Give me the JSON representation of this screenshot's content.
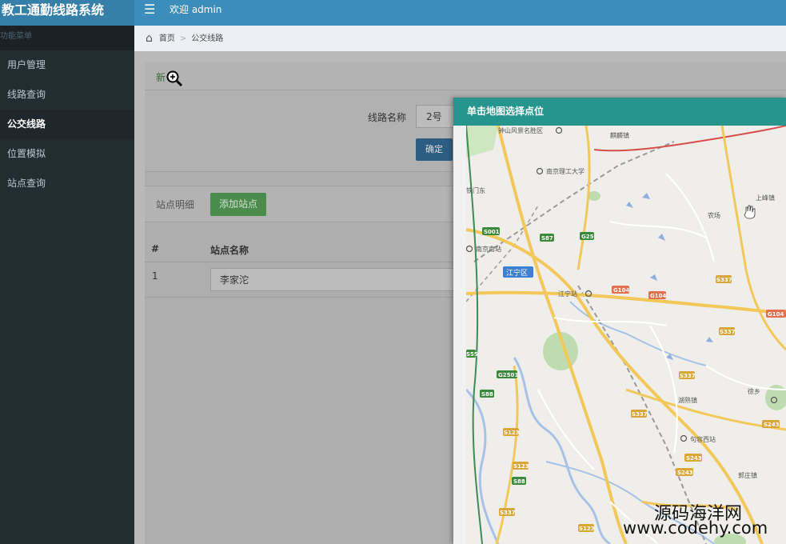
{
  "app": {
    "title": "教工通勤线路系统",
    "menu_icon": "hamburger-icon",
    "welcome": "欢迎 admin"
  },
  "sidebar": {
    "header": "功能菜单",
    "items": [
      {
        "label": "用户管理"
      },
      {
        "label": "线路查询"
      },
      {
        "label": "公交线路",
        "active": true
      },
      {
        "label": "位置模拟"
      },
      {
        "label": "站点查询"
      }
    ]
  },
  "breadcrumb": {
    "icon": "home-icon",
    "home": "首页",
    "separator": ">",
    "current": "公交线路"
  },
  "panel": {
    "new_link": "新",
    "route_name_label": "线路名称",
    "route_name_value": "2号",
    "confirm_label": "确定",
    "station_detail_title": "站点明细",
    "add_station_label": "添加站点",
    "table": {
      "columns": [
        "#",
        "站点名称"
      ],
      "rows": [
        {
          "index": "1",
          "name": "李家沱"
        }
      ]
    }
  },
  "modal": {
    "title": "单击地图选择点位",
    "map": {
      "labels": [
        "钟山风景名胜区",
        "麒麟镇",
        "南京理工大学",
        "南京南站",
        "江宁区",
        "江宁站",
        "农场",
        "上峰镇",
        "湖熟镇",
        "句容西站",
        "郭庄镇",
        "徐乡",
        "铁门东"
      ],
      "road_shields": [
        {
          "text": "S001",
          "color": "#3b8a3b"
        },
        {
          "text": "S87",
          "color": "#3b8a3b"
        },
        {
          "text": "G25",
          "color": "#3b8a3b"
        },
        {
          "text": "G104",
          "color": "#e4704e"
        },
        {
          "text": "G104",
          "color": "#e4704e"
        },
        {
          "text": "G104",
          "color": "#e4704e"
        },
        {
          "text": "S337",
          "color": "#d9a63a"
        },
        {
          "text": "S337",
          "color": "#d9a63a"
        },
        {
          "text": "S337",
          "color": "#d9a63a"
        },
        {
          "text": "S337",
          "color": "#d9a63a"
        },
        {
          "text": "G2501",
          "color": "#3b8a3b"
        },
        {
          "text": "S88",
          "color": "#3b8a3b"
        },
        {
          "text": "S123",
          "color": "#d9a63a"
        },
        {
          "text": "S123",
          "color": "#d9a63a"
        },
        {
          "text": "S88",
          "color": "#3b8a3b"
        },
        {
          "text": "S243",
          "color": "#d9a63a"
        },
        {
          "text": "S243",
          "color": "#d9a63a"
        },
        {
          "text": "S243",
          "color": "#d9a63a"
        },
        {
          "text": "S337",
          "color": "#d9a63a"
        },
        {
          "text": "S123",
          "color": "#d9a63a"
        },
        {
          "text": "S55",
          "color": "#3b8a3b"
        }
      ]
    }
  },
  "watermark": {
    "line1": "源码海洋网",
    "line2": "www.codehy.com"
  },
  "colors": {
    "navbar": "#3c8dbc",
    "brand": "#367fa9",
    "sidebar": "#222d32",
    "modal_header": "#25958e",
    "confirm_button": "#2e5d82",
    "add_button": "#4b8b4b"
  }
}
